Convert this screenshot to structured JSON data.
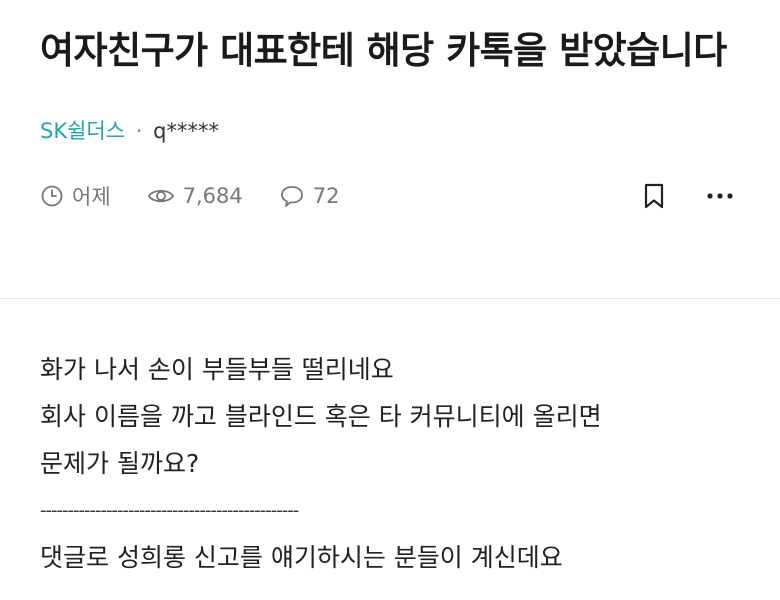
{
  "post": {
    "title": "여자친구가 대표한테 해당 카톡을 받았습니다",
    "company": "SK쉴더스",
    "separator": "·",
    "author": "q*****",
    "time": "어제",
    "views": "7,684",
    "comments": "72"
  },
  "icons": {
    "clock": "clock-icon",
    "views": "eye-icon",
    "comments": "speech-bubble-icon",
    "bookmark": "bookmark-icon",
    "more": "more-dots-icon"
  },
  "body": {
    "lines": [
      "화가 나서 손이 부들부들 떨리네요",
      "회사 이름을 까고 블라인드 혹은 타 커뮤니티에 올리면",
      "문제가 될까요?",
      "-----------------------------------------------",
      "댓글로 성희롱 신고를 얘기하시는 분들이 계신데요"
    ]
  },
  "colors": {
    "company": "#1fa3b5",
    "meta": "#777777",
    "text": "#222222",
    "divider": "#e6e6e6"
  }
}
